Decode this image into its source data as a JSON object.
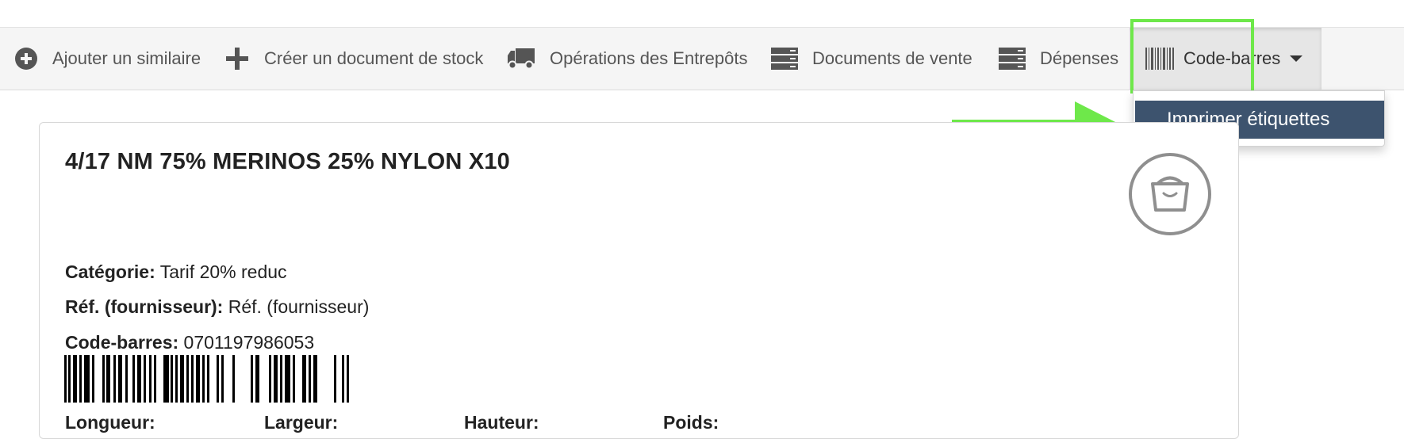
{
  "toolbar": {
    "add_similar": {
      "label": "Ajouter un similaire",
      "icon": "plus-circle-icon"
    },
    "create_stock_doc": {
      "label": "Créer un document de stock",
      "icon": "plus-icon"
    },
    "warehouse_ops": {
      "label": "Opérations des Entrepôts",
      "icon": "truck-icon"
    },
    "sales_docs": {
      "label": "Documents de vente",
      "icon": "server-icon"
    },
    "expenses": {
      "label": "Dépenses",
      "icon": "server-icon"
    },
    "barcode": {
      "label": "Code-barres",
      "icon": "barcode-icon"
    }
  },
  "dropdown": {
    "items": [
      {
        "label": "Imprimer étiquettes"
      }
    ]
  },
  "product": {
    "title": "4/17 NM 75% MERINOS 25% NYLON X10",
    "category_label": "Catégorie:",
    "category_value": "Tarif 20% reduc",
    "supplier_ref_label": "Réf. (fournisseur):",
    "supplier_ref_value": "Réf. (fournisseur)",
    "barcode_label": "Code-barres:",
    "barcode_value": "0701197986053",
    "length_label": "Longueur:",
    "width_label": "Largeur:",
    "height_label": "Hauteur:",
    "weight_label": "Poids:"
  },
  "colors": {
    "highlight": "#6ee84a",
    "dropdown_active": "#3d536e",
    "toolbar_bg": "#f5f5f5"
  }
}
